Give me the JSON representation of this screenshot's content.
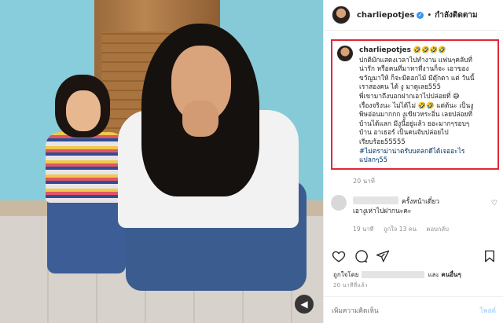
{
  "header": {
    "username": "charliepotjes",
    "separator": "•",
    "follow_label": "กำลังติดตาม"
  },
  "caption": {
    "username": "charliepotjes",
    "emoji": "🤣🤣🤣🤣",
    "lines": [
      "ปกติมักแสดงเวลาไปทำงาน แฟนๆคลับที่",
      "น่ารัก หรือคนที่มาหาที่งานก็จะ เอาของ",
      "ขวัญมาให้ ก็จะมีดอกไม้ มีตุ๊กตา แต่ วันนี้",
      "เราสองคน ได้ งู มาดูเลย555",
      "พี่เขามาถึงบอกฝากเอาไปปล่อยที่ 😅",
      "เรื่องจริงนะ ไม่ได้ไม่ 🤣🤣 แต่ต้นะ เป็นงู",
      "พิษอ่อนมากกก งูเขียวหระอิ่น เลยปล่อยที่",
      "บ้านได้แลก มีงูนี้อยู่แล้ว ยอะมากๆรอบๆ",
      "บ้าน อาเธอร์ เป็นคนจับปล่อยไป",
      "เรียบร้อย55555"
    ],
    "hashtag_lines": [
      "#ไม่ตราม่าน่าตรับบตลกดีได้เจออะไร",
      "แปลกๆ55"
    ],
    "time": "20 นาที"
  },
  "comment": {
    "text": "ครั้งหน้าเดี๋ยว",
    "text2": "เอางูเห่าไปฝากนะคะ",
    "time": "19 นาที",
    "likes": "ถูกใจ 13 คน",
    "reply": "ตอบกลับ"
  },
  "likes": {
    "prefix": "ถูกใจโดย",
    "and": "และ",
    "others": "คนอื่นๆ"
  },
  "post_time": "20 นาทีที่แล้ว",
  "add_comment": {
    "placeholder": "เพิ่มความคิดเห็น",
    "post_label": "โพสต์"
  },
  "colors": {
    "highlight_border": "#e0283a",
    "verified": "#3897f0",
    "hashtag": "#003569"
  }
}
